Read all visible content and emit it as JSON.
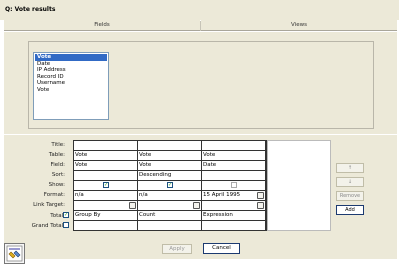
{
  "window": {
    "title": "Q: Vote results"
  },
  "tabs": [
    {
      "label": "Fields"
    },
    {
      "label": "Views"
    }
  ],
  "field_list": {
    "items": [
      "Vote",
      "Date",
      "IP Address",
      "Record ID",
      "Username",
      "Vote"
    ],
    "selected_index": 0
  },
  "design_grid": {
    "row_labels": [
      "Title:",
      "Table:",
      "Field:",
      "Sort:",
      "Show:",
      "Format:",
      "Link Target:",
      "Total:",
      "Grand Total:"
    ],
    "columns": [
      {
        "title": "",
        "table": "Vote",
        "field": "Vote",
        "sort": "",
        "show": true,
        "format": "n/a",
        "total": "Group By"
      },
      {
        "title": "",
        "table": "Vote",
        "field": "Vote",
        "sort": "Descending",
        "show": true,
        "format": "n/a",
        "total": "Count"
      },
      {
        "title": "",
        "table": "Vote",
        "field": "Date",
        "sort": "",
        "show": false,
        "format": "15 April 1995",
        "total": "Expression"
      }
    ],
    "total_checked": true,
    "grand_total_checked": false
  },
  "side_buttons": {
    "up": "↑",
    "down": "↓",
    "remove": "Remove",
    "add": "Add"
  },
  "footer": {
    "apply": "Apply",
    "cancel": "Cancel"
  }
}
